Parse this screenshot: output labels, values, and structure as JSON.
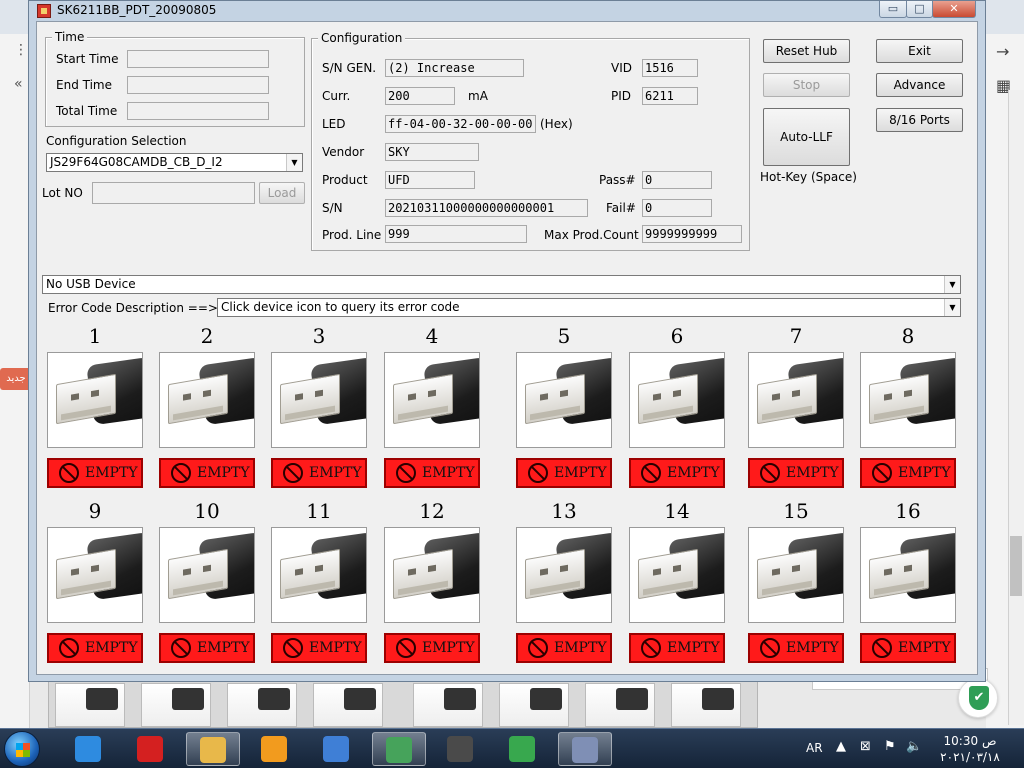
{
  "window": {
    "title": "SK6211BB_PDT_20090805",
    "minimize_glyph": "▭",
    "maximize_glyph": "□",
    "close_glyph": "✕"
  },
  "time_group": {
    "legend": "Time",
    "start_label": "Start Time",
    "start_value": "",
    "end_label": "End Time",
    "end_value": "",
    "total_label": "Total Time",
    "total_value": ""
  },
  "config_selection": {
    "label": "Configuration Selection",
    "value": "JS29F64G08CAMDB_CB_D_I2"
  },
  "lot": {
    "label": "Lot NO",
    "value": "",
    "load_label": "Load"
  },
  "configuration": {
    "legend": "Configuration",
    "sn_gen_label": "S/N GEN.",
    "sn_gen_value": "(2) Increase",
    "curr_label": "Curr.",
    "curr_value": "200",
    "curr_unit": "mA",
    "led_label": "LED",
    "led_value": "ff-04-00-32-00-00-00",
    "led_unit": "(Hex)",
    "vendor_label": "Vendor",
    "vendor_value": "SKY",
    "product_label": "Product",
    "product_value": "UFD",
    "sn_label": "S/N",
    "sn_value": "20210311000000000000001",
    "prod_line_label": "Prod. Line",
    "prod_line_value": "999",
    "vid_label": "VID",
    "vid_value": "1516",
    "pid_label": "PID",
    "pid_value": "6211",
    "pass_label": "Pass#",
    "pass_value": "0",
    "fail_label": "Fail#",
    "fail_value": "0",
    "max_count_label": "Max Prod.Count",
    "max_count_value": "9999999999"
  },
  "buttons": {
    "reset_hub": "Reset Hub",
    "exit": "Exit",
    "stop": "Stop",
    "advance": "Advance",
    "auto_llf": "Auto-LLF",
    "ports": "8/16 Ports",
    "hotkey": "Hot-Key (Space)"
  },
  "usb_device": {
    "value": "No USB Device"
  },
  "error_code": {
    "label": "Error Code Description ==>",
    "value": "Click device icon to query its error code"
  },
  "slots": [
    {
      "num": "1",
      "status": "EMPTY"
    },
    {
      "num": "2",
      "status": "EMPTY"
    },
    {
      "num": "3",
      "status": "EMPTY"
    },
    {
      "num": "4",
      "status": "EMPTY"
    },
    {
      "num": "5",
      "status": "EMPTY"
    },
    {
      "num": "6",
      "status": "EMPTY"
    },
    {
      "num": "7",
      "status": "EMPTY"
    },
    {
      "num": "8",
      "status": "EMPTY"
    },
    {
      "num": "9",
      "status": "EMPTY"
    },
    {
      "num": "10",
      "status": "EMPTY"
    },
    {
      "num": "11",
      "status": "EMPTY"
    },
    {
      "num": "12",
      "status": "EMPTY"
    },
    {
      "num": "13",
      "status": "EMPTY"
    },
    {
      "num": "14",
      "status": "EMPTY"
    },
    {
      "num": "15",
      "status": "EMPTY"
    },
    {
      "num": "16",
      "status": "EMPTY"
    }
  ],
  "background": {
    "side_tab": "جديد"
  },
  "taskbar": {
    "lang": "AR",
    "time": "10:30 ص",
    "date": "٢٠٢١/٠٣/١٨",
    "colors": {
      "ie": "#2e8be0",
      "capture": "#d42020",
      "explorer": "#e8b84a",
      "media": "#f29b1e",
      "swirl": "#3f7fd6",
      "chrome": "#46a35b",
      "n321": "#4a4a4a",
      "download": "#38a84e",
      "mfc": "#7f8fb5"
    }
  }
}
